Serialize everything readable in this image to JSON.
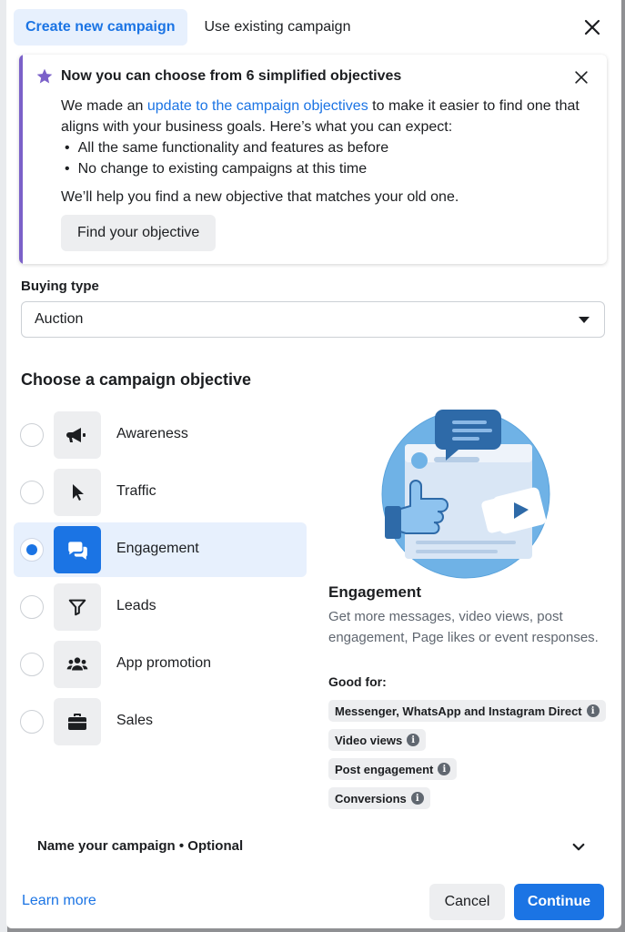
{
  "colors": {
    "accent": "#1b74e4",
    "notice_bar": "#7b61c9",
    "chip_bg": "#edeef0",
    "selected_bg": "#e7f0fd"
  },
  "tabs": [
    {
      "label": "Create new campaign",
      "active": true
    },
    {
      "label": "Use existing campaign",
      "active": false
    }
  ],
  "close_icon": "close-icon",
  "notice": {
    "icon": "star-icon",
    "title": "Now you can choose from 6 simplified objectives",
    "body_prefix": "We made an ",
    "body_link": "update to the campaign objectives",
    "body_suffix": " to make it easier to find one that aligns with your business goals. Here’s what you can expect:",
    "bullets": [
      "All the same functionality and features as before",
      "No change to existing campaigns at this time"
    ],
    "help_text": "We’ll help you find a new objective that matches your old one.",
    "button": "Find your objective"
  },
  "buying_type": {
    "label": "Buying type",
    "value": "Auction"
  },
  "objectives": {
    "title": "Choose a campaign objective",
    "items": [
      {
        "label": "Awareness",
        "icon": "megaphone-icon",
        "selected": false
      },
      {
        "label": "Traffic",
        "icon": "cursor-icon",
        "selected": false
      },
      {
        "label": "Engagement",
        "icon": "chat-bubbles-icon",
        "selected": true
      },
      {
        "label": "Leads",
        "icon": "funnel-icon",
        "selected": false
      },
      {
        "label": "App promotion",
        "icon": "people-icon",
        "selected": false
      },
      {
        "label": "Sales",
        "icon": "briefcase-icon",
        "selected": false
      }
    ]
  },
  "detail": {
    "title": "Engagement",
    "description": "Get more messages, video views, post engagement, Page likes or event responses.",
    "good_for_label": "Good for:",
    "chips": [
      "Messenger, WhatsApp and Instagram Direct",
      "Video views",
      "Post engagement",
      "Conversions"
    ]
  },
  "name_campaign": "Name your campaign • Optional",
  "footer": {
    "learn_more": "Learn more",
    "cancel": "Cancel",
    "continue": "Continue"
  }
}
